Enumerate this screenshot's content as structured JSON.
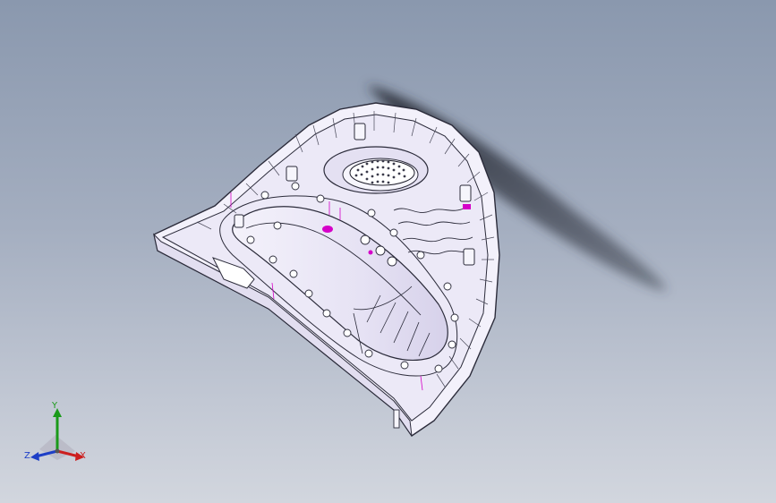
{
  "triad": {
    "x_label": "X",
    "y_label": "Y",
    "z_label": "Z"
  },
  "colors": {
    "background_top": "#8a98ae",
    "background_bottom": "#d2d6de",
    "model_body": "#f3f1fb",
    "model_edges": "#2b2b3a",
    "highlight_magenta": "#d500c8",
    "axis_x": "#cc1f1f",
    "axis_y": "#1a9a1a",
    "axis_z": "#1d3fc7"
  },
  "icons": {
    "triad": "reference-triad-icon"
  }
}
